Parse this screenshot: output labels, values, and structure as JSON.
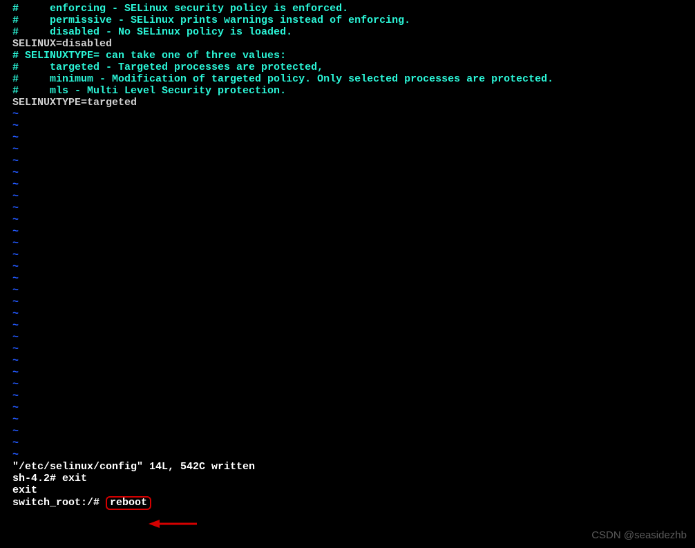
{
  "file": {
    "lines": [
      {
        "cls": "c-cyan",
        "text": "#     enforcing - SELinux security policy is enforced."
      },
      {
        "cls": "c-cyan",
        "text": "#     permissive - SELinux prints warnings instead of enforcing."
      },
      {
        "cls": "c-cyan",
        "text": "#     disabled - No SELinux policy is loaded."
      },
      {
        "cls": "c-grey",
        "text": "SELINUX=disabled"
      },
      {
        "cls": "c-cyan",
        "text": "# SELINUXTYPE= can take one of three values:"
      },
      {
        "cls": "c-cyan",
        "text": "#     targeted - Targeted processes are protected,"
      },
      {
        "cls": "c-cyan",
        "text": "#     minimum - Modification of targeted policy. Only selected processes are protected."
      },
      {
        "cls": "c-cyan",
        "text": "#     mls - Multi Level Security protection."
      },
      {
        "cls": "c-grey",
        "text": "SELINUXTYPE=targeted"
      }
    ]
  },
  "tilde": "~",
  "tildeCount": 30,
  "status": {
    "written": "\"/etc/selinux/config\" 14L, 542C written",
    "shprompt": "sh-4.2# ",
    "exitcmd": "exit",
    "exitecho": "exit",
    "switchprompt": "switch_root:/# ",
    "reboot": "reboot"
  },
  "watermark": "CSDN @seasidezhb"
}
